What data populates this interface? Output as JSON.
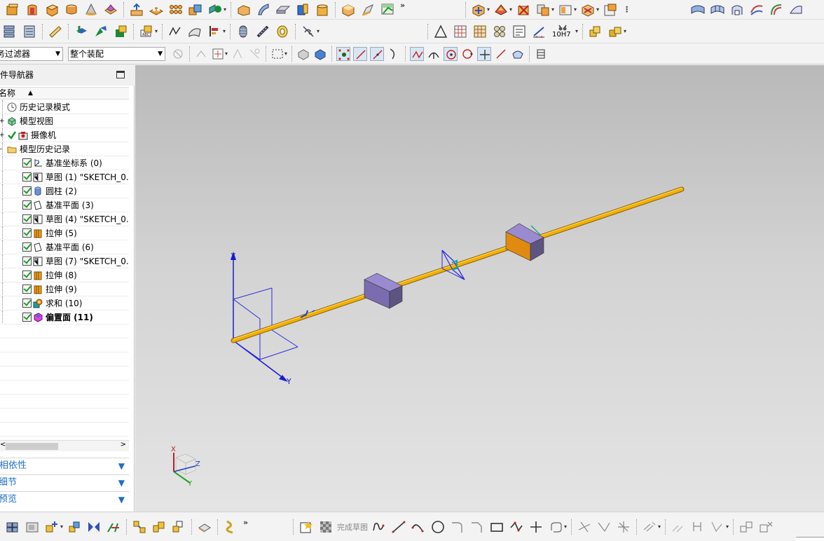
{
  "toolbar3": {
    "filter_value": "类型过滤器",
    "filter_visible": "务过滤器",
    "assembly_value": "整个装配"
  },
  "navigator": {
    "title": "部件导航器",
    "title_visible": "邹件导航器",
    "column_name": "名称",
    "column_name_visible": "名称",
    "items": [
      {
        "label": "历史记录模式",
        "level": 0,
        "checked": false,
        "icon": "clock-icon",
        "bold": false
      },
      {
        "label": "模型视图",
        "level": 0,
        "checked": false,
        "icon": "model-view-icon",
        "bold": false
      },
      {
        "label": "摄像机",
        "level": 0,
        "checked": true,
        "icon": "camera-icon",
        "bold": false
      },
      {
        "label": "模型历史记录",
        "level": 0,
        "checked": false,
        "icon": "folder-icon",
        "bold": false
      },
      {
        "label": "基准坐标系 (0)",
        "level": 1,
        "checked": true,
        "icon": "datum-csys-icon",
        "bold": false
      },
      {
        "label": "草图 (1) \"SKETCH_0..",
        "level": 1,
        "checked": true,
        "icon": "sketch-icon",
        "bold": false
      },
      {
        "label": "圆柱 (2)",
        "level": 1,
        "checked": true,
        "icon": "cylinder-icon",
        "bold": false
      },
      {
        "label": "基准平面 (3)",
        "level": 1,
        "checked": true,
        "icon": "datum-plane-icon",
        "bold": false
      },
      {
        "label": "草图 (4) \"SKETCH_0..",
        "level": 1,
        "checked": true,
        "icon": "sketch-icon",
        "bold": false
      },
      {
        "label": "拉伸 (5)",
        "level": 1,
        "checked": true,
        "icon": "extrude-icon",
        "bold": false
      },
      {
        "label": "基准平面 (6)",
        "level": 1,
        "checked": true,
        "icon": "datum-plane-icon",
        "bold": false
      },
      {
        "label": "草图 (7) \"SKETCH_0..",
        "level": 1,
        "checked": true,
        "icon": "sketch-icon",
        "bold": false
      },
      {
        "label": "拉伸 (8)",
        "level": 1,
        "checked": true,
        "icon": "extrude-icon",
        "bold": false
      },
      {
        "label": "拉伸 (9)",
        "level": 1,
        "checked": true,
        "icon": "extrude-icon",
        "bold": false
      },
      {
        "label": "求和 (10)",
        "level": 1,
        "checked": true,
        "icon": "unite-icon",
        "bold": false
      },
      {
        "label": "偏置面 (11)",
        "level": 1,
        "checked": true,
        "icon": "offset-face-icon",
        "bold": true
      }
    ],
    "panels": [
      "相依性",
      "细节",
      "预览"
    ],
    "panels_visible": [
      "相依性",
      "细节",
      "预览"
    ]
  },
  "bottom_toolbar": {
    "finish_sketch_label": "完成草图"
  },
  "viewport": {
    "axis_labels": {
      "x": "X",
      "y": "Y",
      "z": "Z"
    },
    "triad_labels": {
      "x": "X",
      "y": "Y",
      "z": "Z"
    },
    "colors": {
      "shaft": "#f0b000",
      "block_top": "#9a8bd0",
      "block_side": "#5e5482",
      "block_orange": "#e08a10",
      "datum": "#2020e0"
    }
  },
  "misc": {
    "tolerance_label": "10H7"
  }
}
